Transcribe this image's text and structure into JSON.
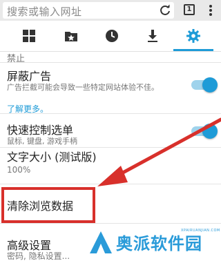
{
  "address_bar": {
    "placeholder": "搜索或输入网址",
    "tab_count": "1"
  },
  "toolbar": {
    "icons": [
      "grid-icon",
      "bookmark-folder-icon",
      "history-clock-icon",
      "download-icon",
      "settings-gear-icon"
    ],
    "active_index": 4,
    "accent_color": "#1e9bd7"
  },
  "settings": {
    "cut_text": "禁止",
    "block_ads": {
      "title": "屏蔽广告",
      "desc": "广告拦截可能会导致一些特定网站体验不佳。",
      "link": "了解更多。",
      "enabled": true
    },
    "quick_control": {
      "title": "快速控制选单",
      "desc": "鼠标, 键盘, 游戏手柄",
      "enabled": true
    },
    "text_size": {
      "title": "文字大小 (测试版)",
      "value": "100%"
    },
    "clear_data": {
      "title": "清除浏览数据"
    },
    "advanced": {
      "title": "高级设置",
      "desc": "密码, 隐私设置..."
    }
  },
  "annotation": {
    "highlight_color": "#d8302b"
  },
  "watermark": {
    "title": "奥派软件园",
    "url": "XPAIRUANJIAN.COM"
  }
}
